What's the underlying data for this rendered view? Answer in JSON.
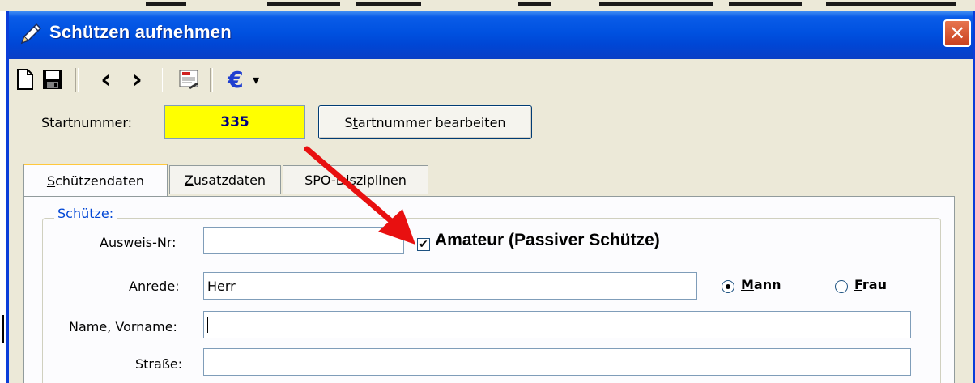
{
  "window": {
    "title": "Schützen aufnehmen",
    "close_glyph": "✕",
    "title_icon": "pencil-icon"
  },
  "toolbar": {
    "items": [
      {
        "name": "new-document-icon"
      },
      {
        "name": "save-icon"
      },
      {
        "name": "previous-record-icon",
        "glyph": "‹"
      },
      {
        "name": "next-record-icon",
        "glyph": "›"
      },
      {
        "name": "print-list-icon"
      },
      {
        "name": "euro-icon",
        "glyph": "€"
      },
      {
        "name": "dropdown-arrow-icon",
        "glyph": "▾"
      }
    ]
  },
  "startnummer": {
    "label": "Startnummer:",
    "value": "335",
    "value_bg": "#ffff00",
    "value_color": "#000080",
    "edit_button": {
      "prefix": "S",
      "accel": "t",
      "rest": "artnummer bearbeiten"
    }
  },
  "tabs": [
    {
      "accel": "S",
      "rest": "chützendaten",
      "active": true
    },
    {
      "accel": "Z",
      "rest": "usatzdaten",
      "active": false
    },
    {
      "accel": "",
      "rest": "SPO-Disziplinen",
      "active": false
    }
  ],
  "group": {
    "title": "Schütze:",
    "title_color": "#0046d5"
  },
  "fields": {
    "ausweis": {
      "label": "Ausweis-Nr:",
      "value": ""
    },
    "amateur": {
      "label": "Amateur (Passiver Schütze)",
      "checked": true,
      "check_glyph": "✔"
    },
    "anrede": {
      "label": "Anrede:",
      "value": "Herr"
    },
    "gender": {
      "mann": {
        "accel": "M",
        "rest": "ann",
        "selected": true
      },
      "frau": {
        "accel": "F",
        "rest": "rau",
        "selected": false
      }
    },
    "name": {
      "label": "Name, Vorname:",
      "value": ""
    },
    "strasse": {
      "label": "Straße:",
      "value": ""
    }
  },
  "annotation": {
    "arrow_color": "#e81010"
  }
}
